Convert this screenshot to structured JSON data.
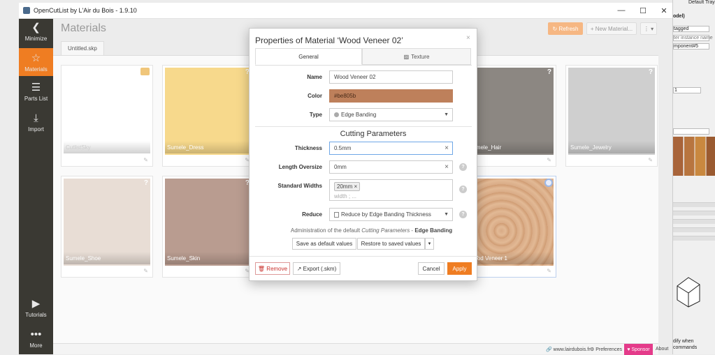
{
  "window": {
    "title": "OpenCutList by L'Air du Bois - 1.9.10",
    "min": "—",
    "max": "☐",
    "close": "✕"
  },
  "sidebar": {
    "items": [
      {
        "label": "Minimize",
        "icon": "❮"
      },
      {
        "label": "Materials",
        "icon": "☆"
      },
      {
        "label": "Parts List",
        "icon": "☰"
      },
      {
        "label": "Import",
        "icon": "⤓"
      },
      {
        "label": "Tutorials",
        "icon": "▶"
      },
      {
        "label": "More",
        "icon": "•••"
      }
    ]
  },
  "header": {
    "title": "Materials",
    "refresh": "↻ Refresh",
    "new_material": "+ New Material...",
    "menu": "⋮ ▾",
    "file_tab": "Untitled.skp"
  },
  "cards": [
    {
      "name": "CutlistSky",
      "color": "#ffffff",
      "mark": "badge"
    },
    {
      "name": "Sumele_Dress",
      "color": "#f7d98c",
      "mark": "?"
    },
    {
      "name": "Sumele_Hair",
      "color": "#8c8782",
      "mark": "?"
    },
    {
      "name": "Sumele_Jewelry",
      "color": "#cfcfcf",
      "mark": "?"
    },
    {
      "name": "Sumele_Shoe",
      "color": "#e8ddd5",
      "mark": "?"
    },
    {
      "name": "Sumele_Skin",
      "color": "#b99c90",
      "mark": "?"
    },
    {
      "name": "Wood Veneer 1",
      "color": "#d4a27a",
      "mark": "ring"
    }
  ],
  "modal": {
    "title": "Properties of Material ‘Wood Veneer 02’",
    "close": "×",
    "tabs": [
      "General",
      "Texture"
    ],
    "texture_icon": "▨",
    "name_label": "Name",
    "name_value": "Wood Veneer 02",
    "color_label": "Color",
    "color_value": "#be805b",
    "type_label": "Type",
    "type_value": "Edge Banding",
    "cutting_title": "Cutting Parameters",
    "thickness_label": "Thickness",
    "thickness_value": "0.5mm",
    "oversize_label": "Length Oversize",
    "oversize_value": "0mm",
    "widths_label": "Standard Widths",
    "widths_chip": "20mm",
    "widths_placeholder": "width ; ...",
    "reduce_label": "Reduce",
    "reduce_value": "Reduce by Edge Banding Thickness",
    "admin_prefix": "Administration of the default ",
    "admin_italic": "Cutting Parameters",
    "admin_sep": " - ",
    "admin_bold": "Edge Banding",
    "save_defaults": "Save as default values",
    "restore": "Restore to saved values",
    "remove": "🗑 Remove",
    "export": "↗ Export (.skm)",
    "cancel": "Cancel",
    "apply": "Apply"
  },
  "status": {
    "site": "🔗 www.lairdubois.fr",
    "preferences": "⚙ Preferences",
    "sponsor": "♥ Sponsor",
    "about": "About"
  },
  "right_panel": {
    "tray": "Default Tray",
    "model": "odel)",
    "tag": "tagged",
    "instance": "ter instance name",
    "component": "mponent#5",
    "num": "1",
    "modify": "dify when",
    "commands": "commands"
  }
}
